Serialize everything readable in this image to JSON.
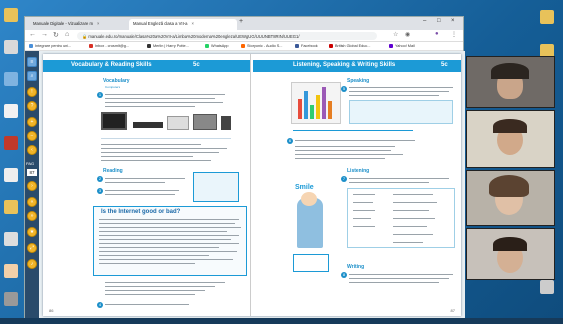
{
  "browser": {
    "tabs": [
      {
        "label": "Manuale Digitale - Vizualizare m",
        "active": false
      },
      {
        "label": "Manual Engleză clasa a VII-a",
        "active": true
      }
    ],
    "new_tab": "+",
    "url": "manuale.edu.ro/manuale/Clasa%20a%20VII-a/Limba%20moderna%20engleza/UEWgUG/UUUNBT8RIN/UUEG1/",
    "bookmarks": [
      {
        "label": "Integrare pentru uni...",
        "color": "#4a90d9"
      },
      {
        "label": "Inbox - crosmlt@g...",
        "color": "#d93025"
      },
      {
        "label": "Merlin | Harry Potte...",
        "color": "#333"
      },
      {
        "label": "WhatsApp",
        "color": "#25d366"
      },
      {
        "label": "Storyonic - Audio S...",
        "color": "#ff6600"
      },
      {
        "label": "Facebook",
        "color": "#3b5998"
      },
      {
        "label": "British Global Educ...",
        "color": "#c00"
      },
      {
        "label": "Yahoo! Mail",
        "color": "#5f01d1"
      }
    ]
  },
  "viewer": {
    "page_label": "PAG",
    "page_number": "87"
  },
  "left_page": {
    "banner": "Vocabulary & Reading Skills",
    "unit": "5c",
    "vocabulary_title": "Vocabulary",
    "vocabulary_sub": "Computers",
    "reading_title": "Reading",
    "article_title": "Is the Internet good or bad?",
    "page_number": "86"
  },
  "right_page": {
    "banner": "Listening, Speaking & Writing Skills",
    "unit": "5c",
    "speaking_title": "Speaking",
    "listening_title": "Listening",
    "writing_title": "Writing",
    "smile_label": "Smile",
    "page_number": "87"
  },
  "desktop": {
    "icons": [
      "PAG"
    ]
  },
  "colors": {
    "banner_blue": "#1c9ad6",
    "tool_orange": "#f0b429"
  }
}
